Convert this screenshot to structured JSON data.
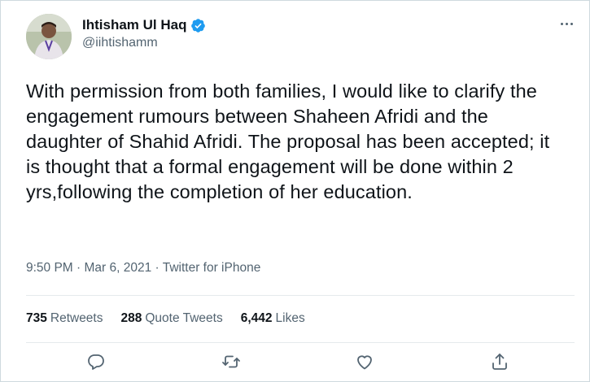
{
  "author": {
    "display_name": "Ihtisham Ul Haq",
    "handle": "@iihtishamm",
    "verified": true,
    "verified_icon": "verified-badge-icon",
    "verified_color": "#1d9bf0"
  },
  "tweet": {
    "text": "With permission from both families, I would like to clarify the engagement rumours between Shaheen Afridi and the daughter of Shahid Afridi. The proposal has been accepted; it is thought that a formal engagement will be done within 2 yrs,following the completion of her education.",
    "timestamp": "9:50 PM · Mar 6, 2021 · Twitter for iPhone"
  },
  "stats": {
    "retweets_count": "735",
    "retweets_label": "Retweets",
    "quote_tweets_count": "288",
    "quote_tweets_label": "Quote Tweets",
    "likes_count": "6,442",
    "likes_label": "Likes"
  },
  "actions": {
    "reply_icon": "reply-icon",
    "retweet_icon": "retweet-icon",
    "like_icon": "like-icon",
    "share_icon": "share-icon",
    "more_icon": "more-options-icon"
  },
  "colors": {
    "text_primary": "#0f1419",
    "text_secondary": "#536471",
    "accent": "#1d9bf0"
  }
}
